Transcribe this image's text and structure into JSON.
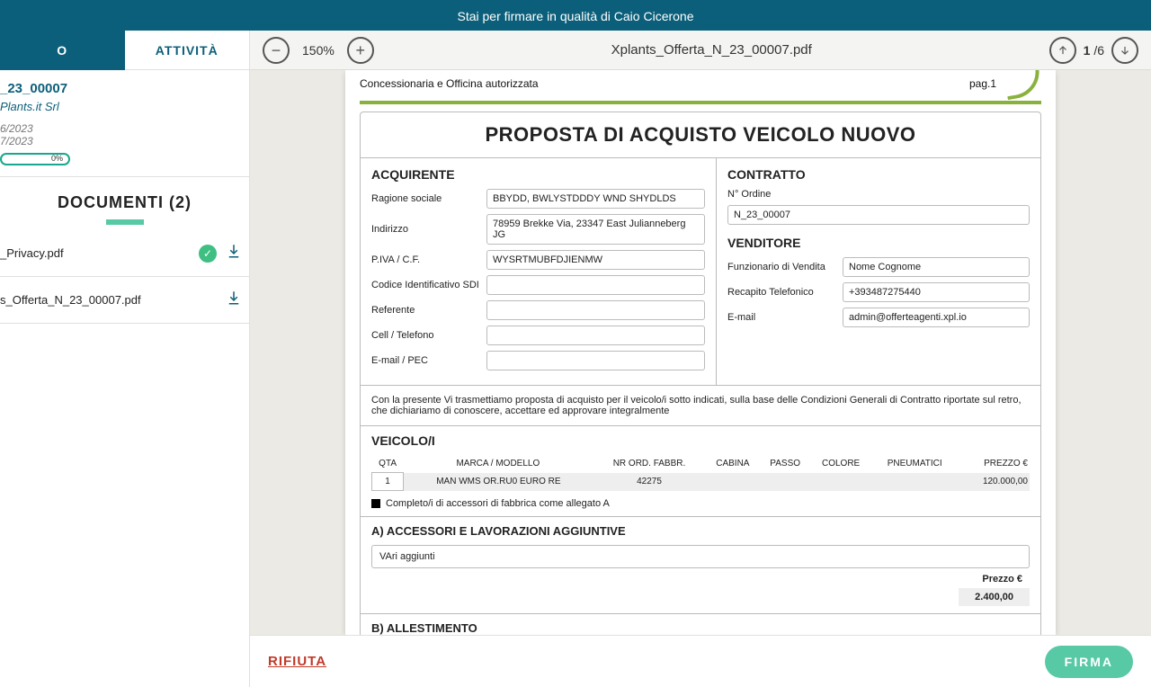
{
  "banner": "Stai per firmare in qualità di Caio Cicerone",
  "tabs": {
    "left": "O",
    "right": "ATTIVITÀ"
  },
  "info": {
    "title": "_23_00007",
    "subtitle": "Plants.it Srl",
    "date1": "6/2023",
    "date2": "7/2023",
    "progress": "0%"
  },
  "docs": {
    "title": "DOCUMENTI (2)",
    "items": [
      {
        "name": "_Privacy.pdf",
        "checked": true
      },
      {
        "name": "s_Offerta_N_23_00007.pdf",
        "checked": false
      }
    ]
  },
  "toolbar": {
    "zoom": "150%",
    "filename": "Xplants_Offerta_N_23_00007.pdf",
    "page_current": "1",
    "page_total": "/6"
  },
  "footer": {
    "reject": "RIFIUTA",
    "sign": "FIRMA"
  },
  "pdf": {
    "header_left": "Concessionaria e Officina autorizzata",
    "header_right": "pag.1",
    "h1": "PROPOSTA DI ACQUISTO VEICOLO NUOVO",
    "acquirente": {
      "title": "ACQUIRENTE",
      "ragione_label": "Ragione sociale",
      "ragione_val": "BBYDD, BWLYSTDDDY WND SHYDLDS",
      "indirizzo_label": "Indirizzo",
      "indirizzo_val": "78959 Brekke Via, 23347 East Julianneberg JG",
      "piva_label": "P.IVA / C.F.",
      "piva_val": "WYSRTMUBFDJIENMW",
      "sdi_label": "Codice Identificativo SDI",
      "sdi_val": "",
      "ref_label": "Referente",
      "ref_val": "",
      "cell_label": "Cell / Telefono",
      "cell_val": "",
      "email_label": "E-mail / PEC",
      "email_val": ""
    },
    "contratto": {
      "title": "CONTRATTO",
      "nord_label": "N° Ordine",
      "nord_val": "N_23_00007"
    },
    "venditore": {
      "title": "VENDITORE",
      "funz_label": "Funzionario di Vendita",
      "funz_val": "Nome Cognome",
      "tel_label": "Recapito Telefonico",
      "tel_val": "+393487275440",
      "email_label": "E-mail",
      "email_val": "admin@offerteagenti.xpl.io"
    },
    "disclaimer": "Con la presente Vi trasmettiamo proposta di acquisto per il veicolo/i sotto indicati, sulla base delle Condizioni Generali di Contratto riportate sul retro, che dichiariamo di conoscere, accettare ed approvare integralmente",
    "veicolo": {
      "title": "VEICOLO/I",
      "headers": [
        "QTA",
        "MARCA / MODELLO",
        "NR ORD. FABBR.",
        "CABINA",
        "PASSO",
        "COLORE",
        "PNEUMATICI",
        "PREZZO €"
      ],
      "row": [
        "1",
        "MAN WMS OR.RU0 EURO RE",
        "42275",
        "",
        "",
        "",
        "",
        "120.000,00"
      ],
      "note": "Completo/i di accessori di fabbrica come allegato A"
    },
    "sec_a": {
      "title": "A) ACCESSORI E LAVORAZIONI AGGIUNTIVE",
      "text": "VAri aggiunti",
      "price_label": "Prezzo €",
      "price_val": "2.400,00"
    },
    "sec_b": {
      "title": "B) ALLESTIMENTO"
    }
  }
}
